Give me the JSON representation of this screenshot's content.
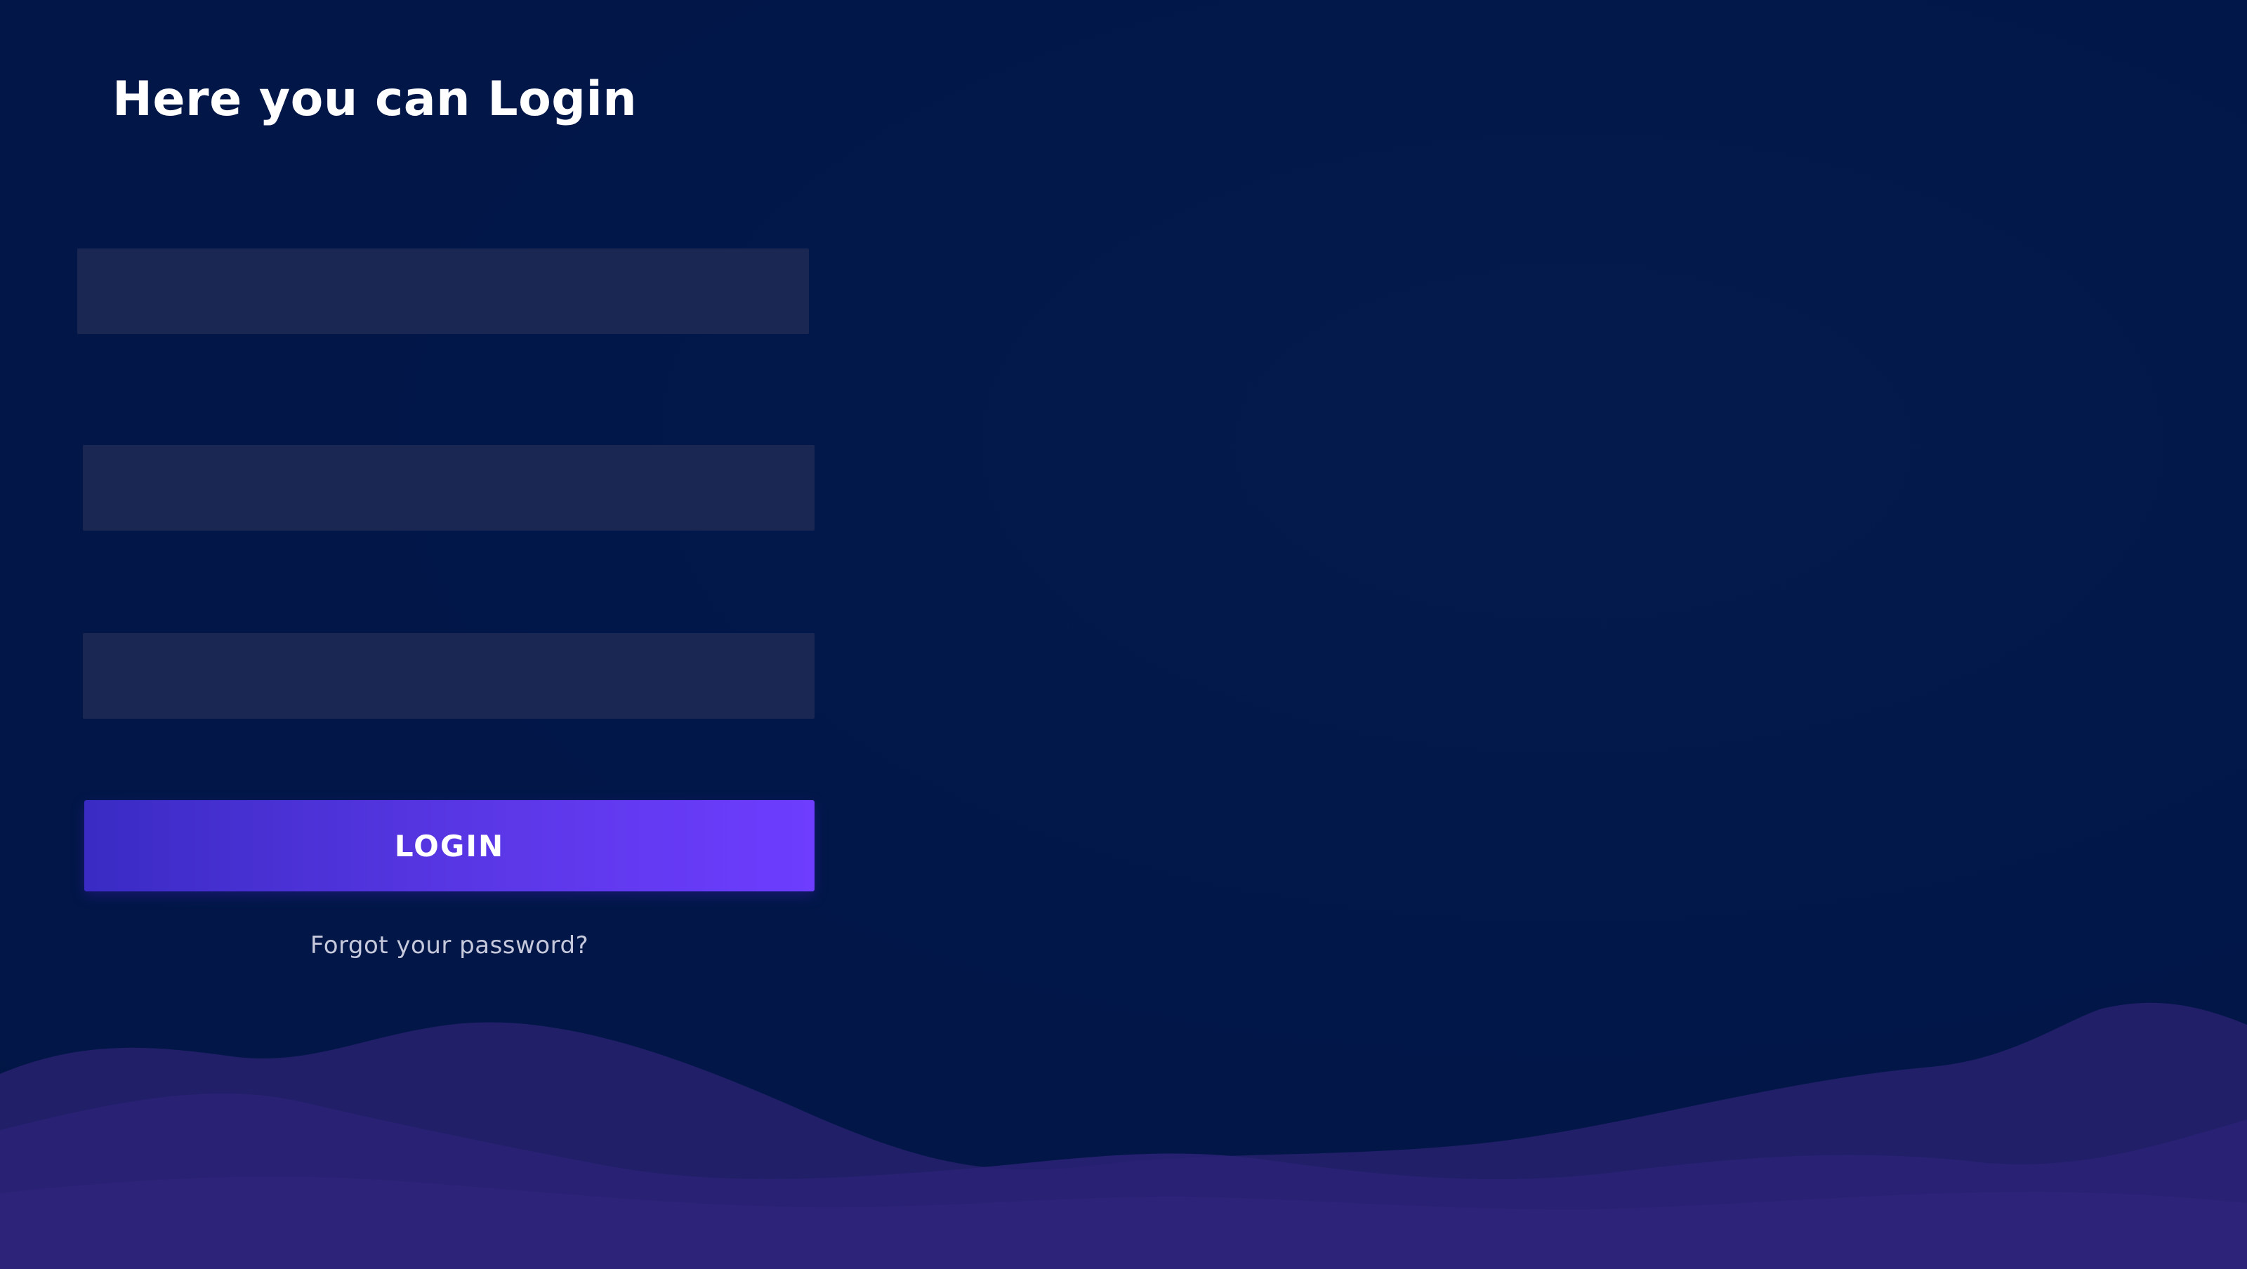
{
  "header": {
    "title": "Here you can Login"
  },
  "form": {
    "fields": [
      {
        "value": "",
        "placeholder": ""
      },
      {
        "value": "",
        "placeholder": ""
      },
      {
        "value": "",
        "placeholder": ""
      }
    ],
    "login_label": "LOGIN",
    "forgot_label": "Forgot your password?"
  },
  "colors": {
    "background": "#02184a",
    "field": "#1a2752",
    "button_start": "#3a2bc4",
    "button_end": "#6e3dff",
    "waves": "#2a2173"
  }
}
